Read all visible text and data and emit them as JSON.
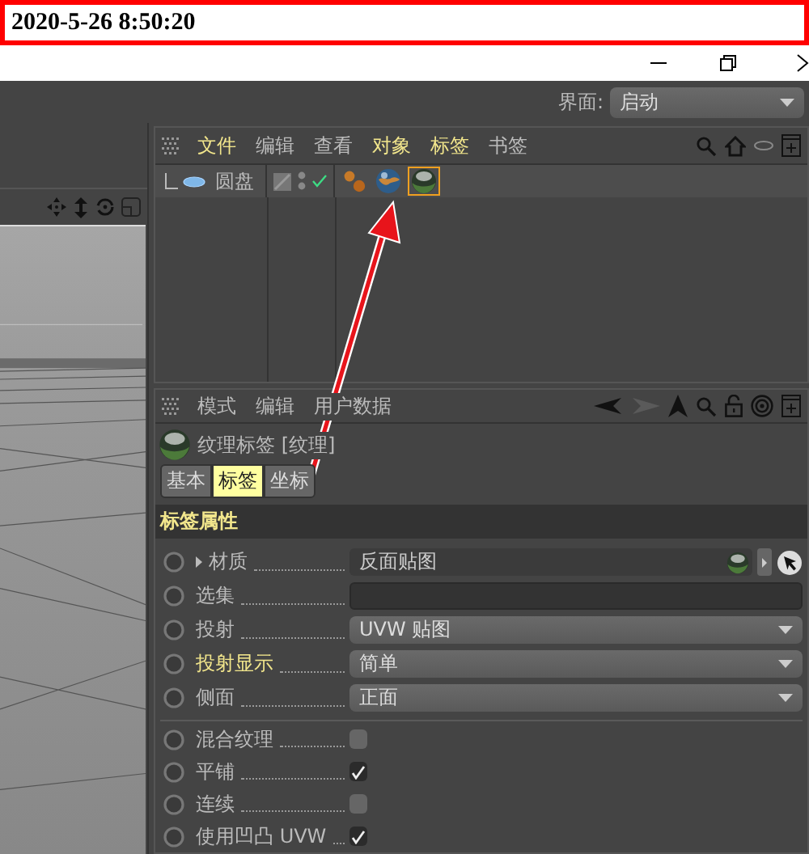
{
  "timestamp": "2020-5-26 8:50:20",
  "layout_picker": {
    "label": "界面:",
    "value": "启动"
  },
  "object_manager": {
    "menu": [
      {
        "label": "文件",
        "highlighted": true
      },
      {
        "label": "编辑",
        "highlighted": false
      },
      {
        "label": "查看",
        "highlighted": false
      },
      {
        "label": "对象",
        "highlighted": true
      },
      {
        "label": "标签",
        "highlighted": true
      },
      {
        "label": "书签",
        "highlighted": false
      }
    ],
    "objects": [
      {
        "name": "圆盘",
        "enabled": true,
        "tags": [
          {
            "kind": "balls",
            "selected": false
          },
          {
            "kind": "globe",
            "selected": false
          },
          {
            "kind": "sphere",
            "selected": true
          }
        ]
      }
    ]
  },
  "attribute_manager": {
    "menu": [
      "模式",
      "编辑",
      "用户数据"
    ],
    "title": "纹理标签 [纹理]",
    "tabs": [
      {
        "label": "基本",
        "selected": false
      },
      {
        "label": "标签",
        "selected": true
      },
      {
        "label": "坐标",
        "selected": false
      }
    ],
    "section": "标签属性",
    "fields": [
      {
        "kind": "link",
        "label": "材质",
        "value": "反面贴图",
        "highlighted": false
      },
      {
        "kind": "text",
        "label": "选集",
        "highlighted": false
      },
      {
        "kind": "dropdown",
        "label": "投射",
        "value": "UVW 贴图",
        "highlighted": false
      },
      {
        "kind": "dropdown",
        "label": "投射显示",
        "value": "简单",
        "highlighted": true
      },
      {
        "kind": "dropdown",
        "label": "侧面",
        "value": "正面",
        "highlighted": false
      }
    ],
    "options": [
      {
        "label": "混合纹理",
        "checked": false
      },
      {
        "label": "平铺",
        "checked": true
      },
      {
        "label": "连续",
        "checked": false
      },
      {
        "label": "使用凹凸 UVW",
        "checked": true
      }
    ]
  }
}
